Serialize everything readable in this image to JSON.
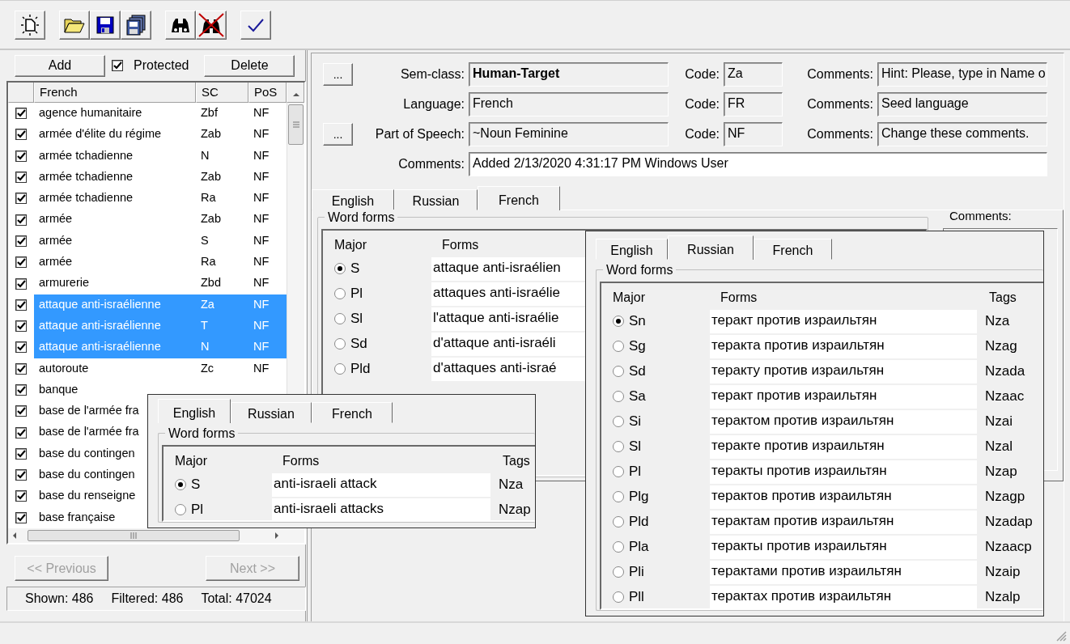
{
  "left": {
    "add_button": "Add",
    "protected": {
      "label": "Protected",
      "checked": true
    },
    "delete_button": "Delete",
    "list": {
      "columns": [
        "French",
        "SC",
        "PoS"
      ],
      "rows": [
        {
          "text": "agence humanitaire",
          "sc": "Zbf",
          "pos": "NF",
          "checked": true,
          "selected": false
        },
        {
          "text": "armée d'élite du régime",
          "sc": "Zab",
          "pos": "NF",
          "checked": true,
          "selected": false
        },
        {
          "text": "armée tchadienne",
          "sc": "N",
          "pos": "NF",
          "checked": true,
          "selected": false
        },
        {
          "text": "armée tchadienne",
          "sc": "Zab",
          "pos": "NF",
          "checked": true,
          "selected": false
        },
        {
          "text": "armée tchadienne",
          "sc": "Ra",
          "pos": "NF",
          "checked": true,
          "selected": false
        },
        {
          "text": "armée",
          "sc": "Zab",
          "pos": "NF",
          "checked": true,
          "selected": false
        },
        {
          "text": "armée",
          "sc": "S",
          "pos": "NF",
          "checked": true,
          "selected": false
        },
        {
          "text": "armée",
          "sc": "Ra",
          "pos": "NF",
          "checked": true,
          "selected": false
        },
        {
          "text": "armurerie",
          "sc": "Zbd",
          "pos": "NF",
          "checked": true,
          "selected": false
        },
        {
          "text": "attaque anti-israélienne",
          "sc": "Za",
          "pos": "NF",
          "checked": true,
          "selected": true
        },
        {
          "text": "attaque anti-israélienne",
          "sc": "T",
          "pos": "NF",
          "checked": true,
          "selected": true
        },
        {
          "text": "attaque anti-israélienne",
          "sc": "N",
          "pos": "NF",
          "checked": true,
          "selected": true
        },
        {
          "text": "autoroute",
          "sc": "Zc",
          "pos": "NF",
          "checked": true,
          "selected": false
        },
        {
          "text": "banque",
          "checked": true,
          "selected": false
        },
        {
          "text": "base de l'armée fra",
          "checked": true,
          "selected": false
        },
        {
          "text": "base de l'armée fra",
          "checked": true,
          "selected": false
        },
        {
          "text": "base du contingen",
          "checked": true,
          "selected": false
        },
        {
          "text": "base du contingen",
          "checked": true,
          "selected": false
        },
        {
          "text": "base du renseigne",
          "checked": true,
          "selected": false
        },
        {
          "text": "base française",
          "checked": true,
          "selected": false
        }
      ]
    },
    "previous_button": {
      "label": "<< Previous",
      "disabled": true
    },
    "next_button": {
      "label": "Next >>",
      "disabled": true
    },
    "counts": [
      "Shown: 486",
      "Filtered: 486",
      "Total: 47024"
    ]
  },
  "details": {
    "fields": [
      {
        "button": "...",
        "label": "Sem-class:",
        "value": "Human-Target",
        "bold": true,
        "code_label": "Code:",
        "code": "Za",
        "comments_label": "Comments:",
        "comments": "Hint: Please, type in Name o"
      },
      {
        "label": "Language:",
        "value": "French",
        "bold": false,
        "code_label": "Code:",
        "code": "FR",
        "comments_label": "Comments:",
        "comments": "Seed  language"
      },
      {
        "button": "...",
        "label": "Part of Speech:",
        "value": "~Noun Feminine",
        "bold": false,
        "code_label": "Code:",
        "code": "NF",
        "comments_label": "Comments:",
        "comments": "Change these comments."
      }
    ],
    "comments": {
      "label": "Comments:",
      "value": "Added 2/13/2020  4:31:17 PM  Windows User"
    },
    "tabs": [
      {
        "label": "English",
        "selected": false
      },
      {
        "label": "Russian",
        "selected": false
      },
      {
        "label": "French",
        "selected": true
      }
    ],
    "word_forms": {
      "legend": "Word forms",
      "columns": [
        "Major",
        "Forms"
      ],
      "rows": [
        {
          "major": "S",
          "form": "attaque anti-israélien",
          "selected": true
        },
        {
          "major": "Pl",
          "form": "attaques anti-israélie",
          "selected": false
        },
        {
          "major": "Sl",
          "form": "l'attaque anti-israélie",
          "selected": false
        },
        {
          "major": "Sd",
          "form": "d'attaque anti-israéli",
          "selected": false
        },
        {
          "major": "Pld",
          "form": "d'attaques anti-israé",
          "selected": false
        }
      ]
    },
    "side_comments_label": "Comments:"
  },
  "popups": [
    {
      "tabs": [
        {
          "label": "English",
          "selected": true
        },
        {
          "label": "Russian",
          "selected": false
        },
        {
          "label": "French",
          "selected": false
        }
      ],
      "legend": "Word forms",
      "columns": [
        "Major",
        "Forms",
        "Tags"
      ],
      "rows": [
        {
          "major": "S",
          "form": "anti-israeli attack",
          "tag": "Nza",
          "selected": true
        },
        {
          "major": "Pl",
          "form": "anti-israeli attacks",
          "tag": "Nzap",
          "selected": false
        }
      ]
    },
    {
      "tabs": [
        {
          "label": "English",
          "selected": false
        },
        {
          "label": "Russian",
          "selected": true
        },
        {
          "label": "French",
          "selected": false
        }
      ],
      "legend": "Word forms",
      "columns": [
        "Major",
        "Forms",
        "Tags"
      ],
      "rows": [
        {
          "major": "Sn",
          "form": "теракт против израильтян",
          "tag": "Nza",
          "selected": true
        },
        {
          "major": "Sg",
          "form": "теракта против израильтян",
          "tag": "Nzag",
          "selected": false
        },
        {
          "major": "Sd",
          "form": "теракту против израильтян",
          "tag": "Nzada",
          "selected": false
        },
        {
          "major": "Sa",
          "form": "теракт против израильтян",
          "tag": "Nzaac",
          "selected": false
        },
        {
          "major": "Si",
          "form": "терактом против израильтян",
          "tag": "Nzai",
          "selected": false
        },
        {
          "major": "Sl",
          "form": "теракте против израильтян",
          "tag": "Nzal",
          "selected": false
        },
        {
          "major": "Pl",
          "form": "теракты против израильтян",
          "tag": "Nzap",
          "selected": false
        },
        {
          "major": "Plg",
          "form": "терактов против израильтян",
          "tag": "Nzagp",
          "selected": false
        },
        {
          "major": "Pld",
          "form": "терактам против израильтян",
          "tag": "Nzadap",
          "selected": false
        },
        {
          "major": "Pla",
          "form": "теракты против израильтян",
          "tag": "Nzaacp",
          "selected": false
        },
        {
          "major": "Pli",
          "form": "терактами против израильтян",
          "tag": "Nzaip",
          "selected": false
        },
        {
          "major": "Pll",
          "form": "терактах против израильтян",
          "tag": "Nzalp",
          "selected": false
        }
      ]
    }
  ]
}
